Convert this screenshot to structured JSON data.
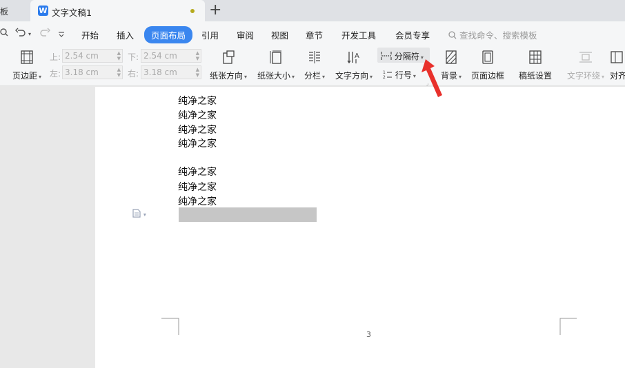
{
  "tabs": {
    "prev_tab_label": "板",
    "active_tab_title": "文字文稿1",
    "logo_letter": "W",
    "new_tab": "+"
  },
  "menu": {
    "items": [
      "开始",
      "插入",
      "页面布局",
      "引用",
      "审阅",
      "视图",
      "章节",
      "开发工具",
      "会员专享"
    ],
    "active_index": 2,
    "search_placeholder": "查找命令、搜索模板"
  },
  "ribbon": {
    "margins_label": "页边距",
    "top_label": "上:",
    "top_value": "2.54 cm",
    "bottom_label": "下:",
    "bottom_value": "2.54 cm",
    "left_label": "左:",
    "left_value": "3.18 cm",
    "right_label": "右:",
    "right_value": "3.18 cm",
    "orientation_label": "纸张方向",
    "size_label": "纸张大小",
    "columns_label": "分栏",
    "text_direction_label": "文字方向",
    "breaks_label": "分隔符",
    "line_numbers_label": "行号",
    "background_label": "背景",
    "page_border_label": "页面边框",
    "manuscript_label": "稿纸设置",
    "text_wrap_label": "文字环绕",
    "align_label": "对齐"
  },
  "document": {
    "lines": [
      "纯净之家",
      "纯净之家",
      "纯净之家",
      "纯净之家",
      "",
      "纯净之家",
      "纯净之家",
      "纯净之家"
    ],
    "page_number": "3"
  },
  "colors": {
    "accent": "#3a86ef",
    "highlight": "#c6c6c6",
    "arrow": "#e8302b"
  }
}
